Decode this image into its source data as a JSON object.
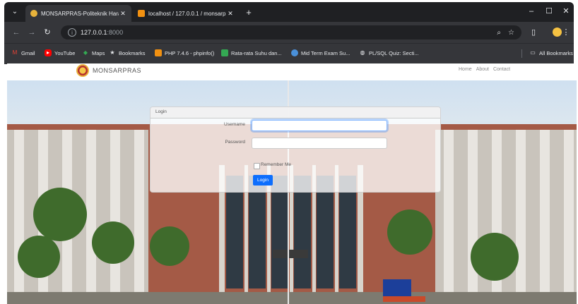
{
  "browser": {
    "tabs": [
      {
        "title": "MONSARPRAS-Politeknik Hara",
        "active": true
      },
      {
        "title": "localhost / 127.0.0.1 / monsarp",
        "active": false
      }
    ],
    "url_host": "127.0.0.1",
    "url_port": ":8000",
    "bookmarks": [
      {
        "label": "Gmail"
      },
      {
        "label": "YouTube"
      },
      {
        "label": "Maps"
      },
      {
        "label": "Bookmarks"
      },
      {
        "label": "PHP 7.4.6 - phpinfo()"
      },
      {
        "label": "Rata-rata Suhu dan..."
      },
      {
        "label": "Mid Term Exam Su..."
      },
      {
        "label": "PL/SQL Quiz: Secti..."
      }
    ],
    "all_bookmarks": "All Bookmarks"
  },
  "site": {
    "brand": "MONSARPRAS",
    "nav": {
      "home": "Home",
      "about": "About",
      "contact": "Contact"
    }
  },
  "login": {
    "header": "Login",
    "username_label": "Username",
    "username_value": "",
    "password_label": "Password",
    "password_value": "",
    "remember_label": "Remember Me",
    "submit": "Login"
  },
  "colors": {
    "accent": "#0d6efd",
    "chrome_dark": "#202124"
  }
}
